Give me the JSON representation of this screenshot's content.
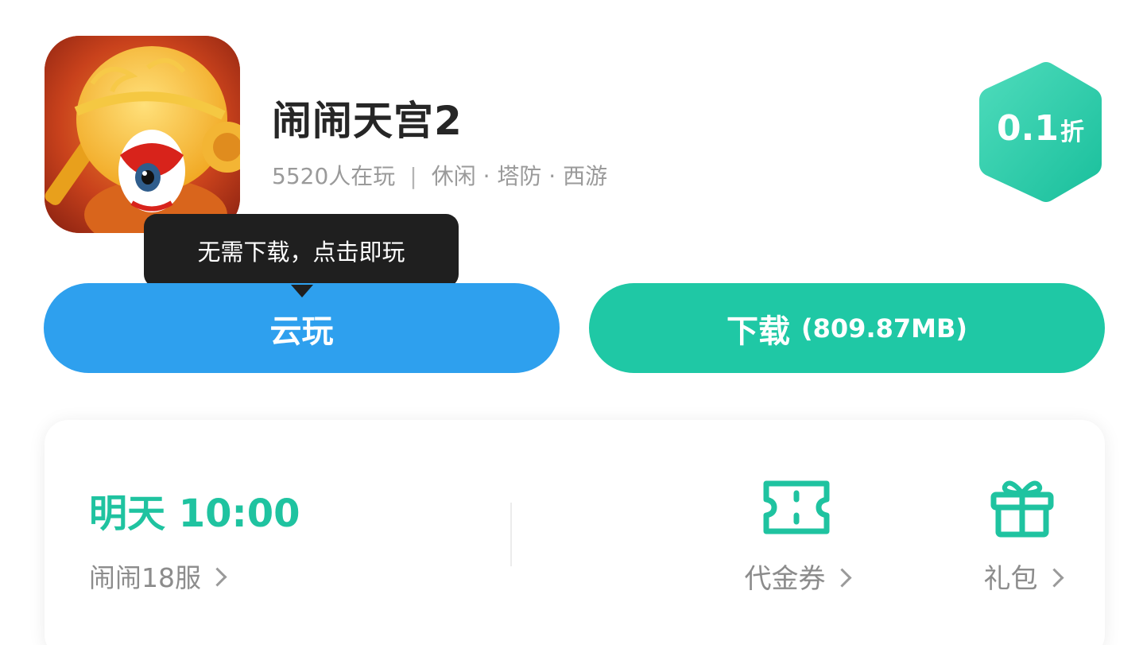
{
  "game": {
    "title": "闹闹天宫2",
    "players": "5520人在玩",
    "separator": "|",
    "tags": "休闲 · 塔防 · 西游",
    "icon": "game-icon-monkey-king"
  },
  "discount": {
    "value": "0.1",
    "unit": "折",
    "color": "#1fc8a5"
  },
  "tooltip": {
    "text": "无需下载，点击即玩"
  },
  "buttons": {
    "cloud_label": "云玩",
    "cloud_color": "#2ea0ee",
    "download_label": "下载",
    "download_size": "(809.87MB)",
    "download_color": "#1fc8a5"
  },
  "server": {
    "time": "明天 10:00",
    "name": "闹闹18服"
  },
  "actions": {
    "voucher_label": "代金券",
    "voucher_icon": "ticket-icon",
    "gift_label": "礼包",
    "gift_icon": "gift-icon"
  }
}
